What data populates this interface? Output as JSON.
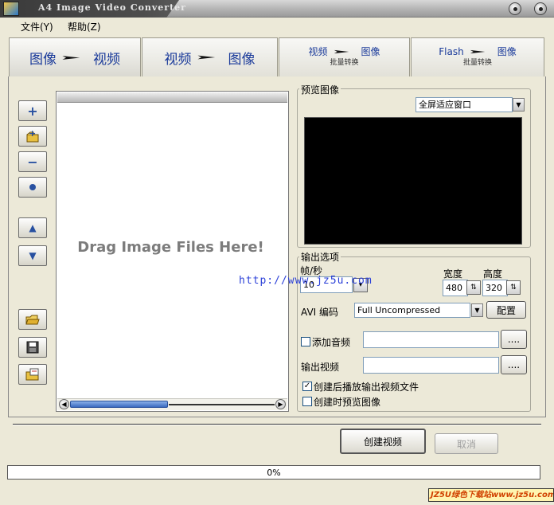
{
  "window": {
    "title": "A4 Image Video Converter"
  },
  "menu": {
    "file": "文件(Y)",
    "help": "帮助(Z)"
  },
  "tabs": [
    {
      "left": "图像",
      "right": "视频"
    },
    {
      "left": "视频",
      "right": "图像"
    },
    {
      "left": "视频",
      "right": "图像",
      "sub": "批量转换"
    },
    {
      "left": "Flash",
      "right": "图像",
      "sub": "批量转换"
    }
  ],
  "toolbar": {
    "add": "+",
    "remove": "−",
    "up": "▲",
    "down": "▼"
  },
  "droparea": {
    "hint": "Drag Image Files Here!"
  },
  "preview": {
    "legend": "预览图像",
    "mode_selected": "全屏适应窗口"
  },
  "output": {
    "legend": "输出选项",
    "fps_label": "帧/秒",
    "fps_value": "10",
    "width_label": "宽度",
    "width_value": "480",
    "height_label": "高度",
    "height_value": "320",
    "codec_label": "AVI 编码",
    "codec_selected": "Full Uncompressed",
    "config_button": "配置",
    "add_audio_label": "添加音频",
    "add_audio_checked": false,
    "output_video_label": "输出视频",
    "browse": "....",
    "play_after_create_label": "创建后播放输出视频文件",
    "play_after_create_checked": true,
    "preview_when_create_label": "创建时预览图像",
    "preview_when_create_checked": false
  },
  "actions": {
    "create": "创建视频",
    "cancel": "取消"
  },
  "progress": {
    "text": "0%",
    "value": 0
  },
  "watermark": {
    "url": "http://www.jz5u.com",
    "badge": "JZ5U绿色下载站www.jz5u.com"
  },
  "colors": {
    "preview_bg": "#000000",
    "tab_text": "#1a3a9a",
    "window_bg": "#ece9d8"
  }
}
